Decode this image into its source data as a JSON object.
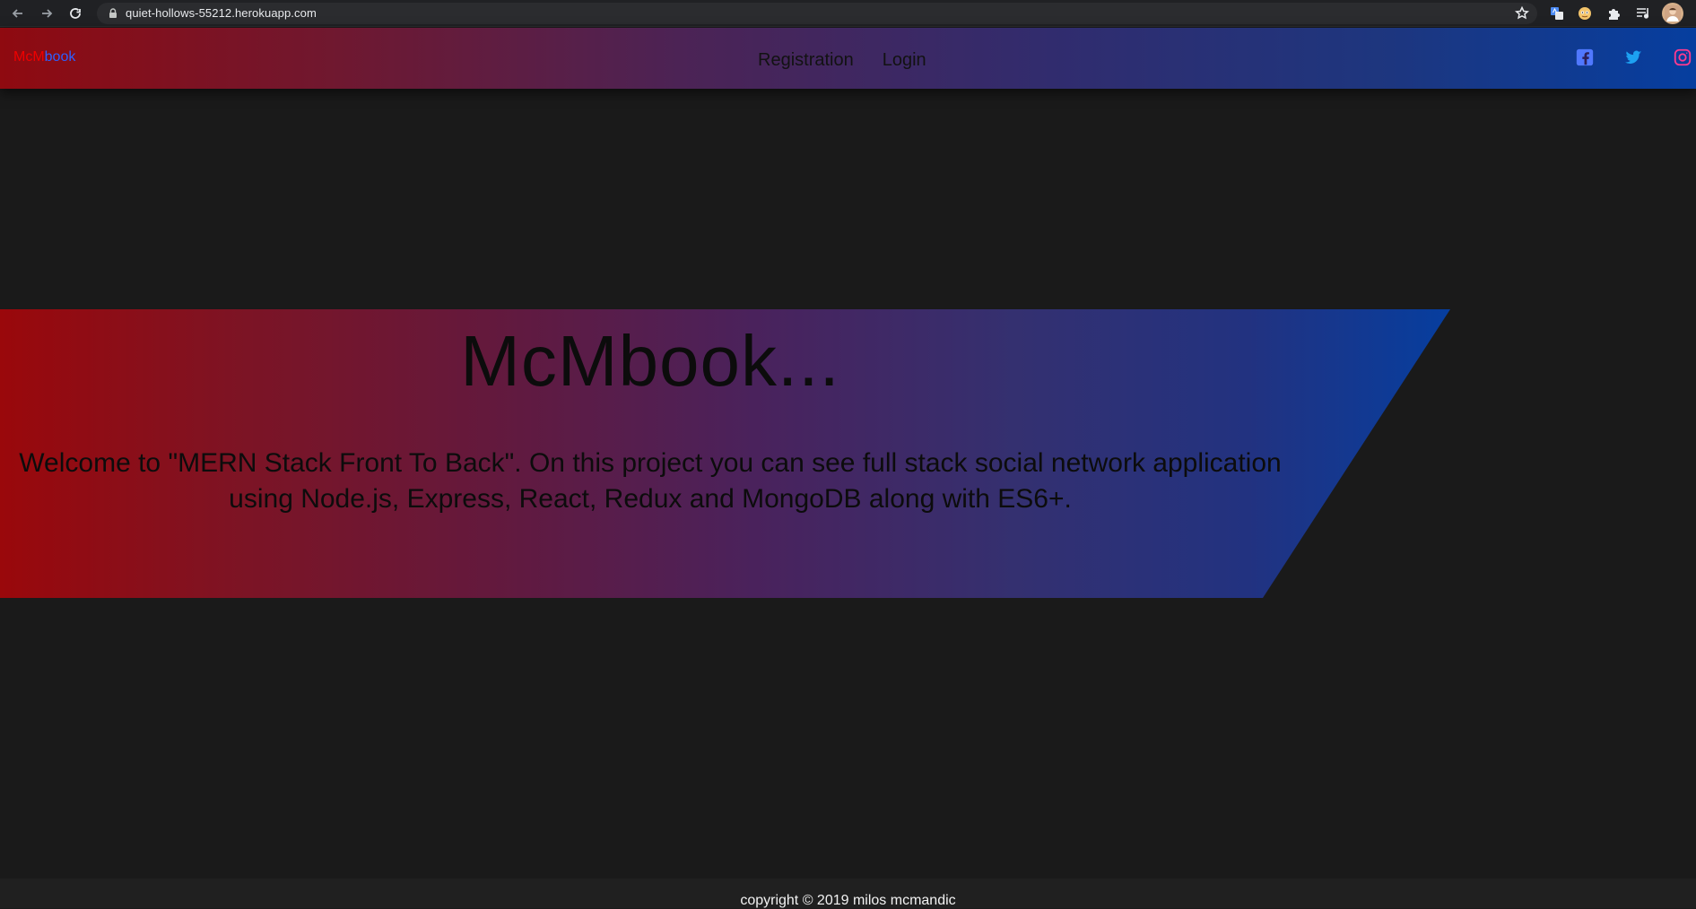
{
  "browser": {
    "url": "quiet-hollows-55212.herokuapp.com",
    "icons": [
      "back-icon",
      "forward-icon",
      "reload-icon",
      "lock-icon",
      "star-icon",
      "translate-icon",
      "extension-face-icon",
      "puzzle-icon",
      "media-control-icon",
      "profile-avatar"
    ]
  },
  "nav": {
    "brand_mcm": "McM",
    "brand_book": "book",
    "links": [
      "Registration",
      "Login"
    ],
    "social_icons": [
      "facebook-icon",
      "twitter-icon",
      "instagram-icon"
    ]
  },
  "hero": {
    "title": "McMbook...",
    "description": "Welcome to \"MERN Stack Front To Back\". On this project you can see full stack social network application using Node.js, Express, React, Redux and MongoDB along with ES6+."
  },
  "footer": {
    "text": "copyright © 2019 milos mcmandic"
  },
  "colors": {
    "brand_mcm": "#f00000",
    "brand_book": "#2d5fff",
    "banner_start": "#9a080b",
    "banner_end": "#063e9f",
    "page_background": "#1a1a1a"
  }
}
